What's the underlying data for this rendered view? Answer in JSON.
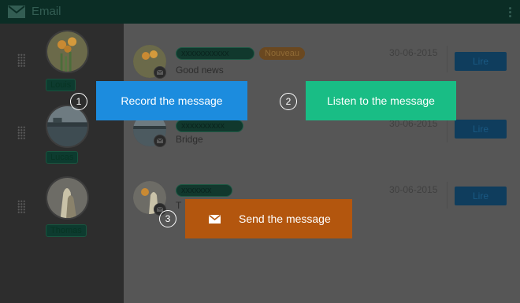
{
  "app": {
    "title": "Email"
  },
  "contacts": [
    {
      "name": "Louis"
    },
    {
      "name": "Lucas"
    },
    {
      "name": "Thomas"
    }
  ],
  "messages": [
    {
      "sender": "xxxxxxxxxxx",
      "badge": "Nouveau",
      "subject": "Good news",
      "date": "30-06-2015",
      "read_label": "Lire"
    },
    {
      "sender": "xxxxxxxxxx",
      "subject": "Bridge",
      "date": "30-06-2015",
      "read_label": "Lire"
    },
    {
      "sender": "xxxxxxx",
      "subject": "T",
      "date": "30-06-2015",
      "read_label": "Lire"
    }
  ],
  "overlays": {
    "record": {
      "step": "1",
      "label": "Record the message",
      "color": "#1c8cde"
    },
    "listen": {
      "step": "2",
      "label": "Listen to the message",
      "color": "#19bd85"
    },
    "send": {
      "step": "3",
      "label": "Send the message",
      "color": "#b3560e",
      "icon": "mail-icon"
    }
  },
  "colors": {
    "topbar": "#0b2d25",
    "sidebar": "#2d2d2d",
    "main": "#565656",
    "read_button": "#0f3d5d"
  }
}
